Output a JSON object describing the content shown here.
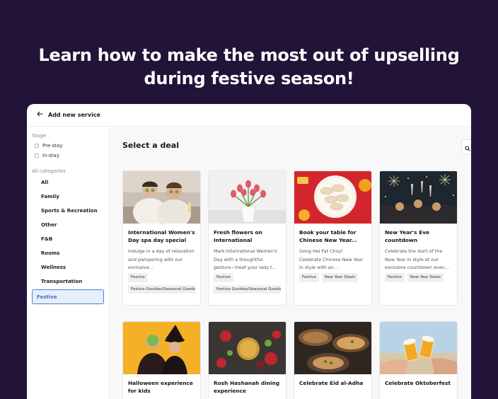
{
  "headline": {
    "line1": "Learn how to make the most out of upselling",
    "line2": "during festive season!"
  },
  "topbar": {
    "back_icon": "arrow-left-icon",
    "title": "Add new service"
  },
  "sidebar": {
    "stage_label": "Stage",
    "stages": [
      "Pre-stay",
      "In-stay"
    ],
    "categories_label": "All categories",
    "categories": [
      "All",
      "Family",
      "Sports & Recreation",
      "Other",
      "F&B",
      "Rooms",
      "Wellness",
      "Transportation",
      "Festive"
    ],
    "active_category": "Festive"
  },
  "main": {
    "title": "Select a deal",
    "search_icon": "search-icon",
    "cards": [
      {
        "title": "International Women's Day spa day special",
        "desc": "Indulge in a day of relaxation and pampering with our exclusive...",
        "tags": [
          "Festive",
          "Festive Goodies/Seasonal Goodies"
        ]
      },
      {
        "title": "Fresh flowers on International Women's...",
        "desc": "Mark International Women's Day with a thoughtful gesture—treat your lady t...",
        "tags": [
          "Festive",
          "Festive Goodies/Seasonal Goodies"
        ]
      },
      {
        "title": "Book your table for Chinese New Year...",
        "desc": "Gong Hei Fat Choy! Celebrate Chinese New Year in style with an...",
        "tags": [
          "Festive",
          "New Year Deals"
        ]
      },
      {
        "title": "New Year's Eve countdown",
        "desc": "Celebrate the start of the New Year in style at our exclusive countdown even...",
        "tags": [
          "Festive",
          "New Year Deals"
        ]
      },
      {
        "title": "Halloween experience for kids",
        "desc": "",
        "tags": []
      },
      {
        "title": "Rosh Hashanah dining experience",
        "desc": "",
        "tags": []
      },
      {
        "title": "Celebrate Eid al-Adha",
        "desc": "",
        "tags": []
      },
      {
        "title": "Celebrate Oktoberfest",
        "desc": "",
        "tags": []
      }
    ]
  },
  "colors": {
    "background": "#221339",
    "accent": "#3d73cf",
    "active_bg": "#e6eefc"
  }
}
